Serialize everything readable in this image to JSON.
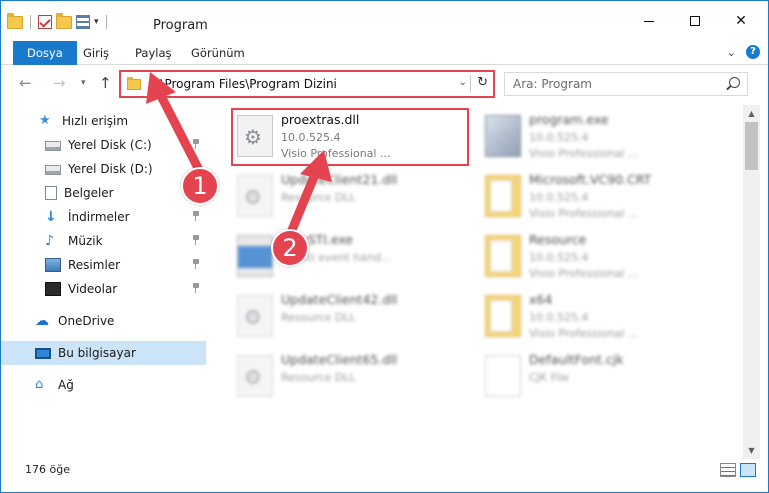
{
  "window": {
    "title": "Program",
    "controls": {
      "minimize": "",
      "maximize": "",
      "close": "✕"
    }
  },
  "ribbon": {
    "tabs": [
      "Dosya",
      "Giriş",
      "Paylaş",
      "Görünüm"
    ]
  },
  "address": {
    "path": "C:\\Program Files\\Program Dizini",
    "search_placeholder": "Ara: Program"
  },
  "sidebar": {
    "items": [
      {
        "label": "Hızlı erişim",
        "icon": "star-icon"
      },
      {
        "label": "Yerel Disk (C:)",
        "icon": "disk-icon",
        "pinned": true
      },
      {
        "label": "Yerel Disk (D:)",
        "icon": "disk-icon",
        "pinned": true
      },
      {
        "label": "Belgeler",
        "icon": "documents-icon",
        "pinned": true
      },
      {
        "label": "İndirmeler",
        "icon": "downloads-icon",
        "pinned": true
      },
      {
        "label": "Müzik",
        "icon": "music-icon",
        "pinned": true
      },
      {
        "label": "Resimler",
        "icon": "pictures-icon",
        "pinned": true
      },
      {
        "label": "Videolar",
        "icon": "videos-icon",
        "pinned": true
      },
      {
        "label": "OneDrive",
        "icon": "onedrive-icon"
      },
      {
        "label": "Bu bilgisayar",
        "icon": "computer-icon",
        "selected": true
      },
      {
        "label": "Ağ",
        "icon": "network-icon"
      }
    ]
  },
  "files": [
    {
      "name": "proextras.dll",
      "line2": "10.0.525.4",
      "line3": "Visio Professional ...",
      "icon": "dll-icon"
    },
    {
      "name": "program.exe",
      "line2": "10.0.525.4",
      "line3": "Visio Professional ...",
      "icon": "exe-icon"
    },
    {
      "name": "UpdateClient21.dll",
      "line2": "Resource DLL",
      "line3": "",
      "icon": "dll-icon"
    },
    {
      "name": "Microsoft.VC90.CRT",
      "line2": "10.0.525.4",
      "line3": "Visio Professional ...",
      "icon": "folder-icon"
    },
    {
      "name": "...yySTI.exe",
      "line2": "...Y sti event hand...",
      "line3": "",
      "icon": "app-icon"
    },
    {
      "name": "Resource",
      "line2": "10.0.525.4",
      "line3": "Visio Professional ...",
      "icon": "folder-icon"
    },
    {
      "name": "UpdateClient42.dll",
      "line2": "Resource DLL",
      "line3": "",
      "icon": "dll-icon"
    },
    {
      "name": "x64",
      "line2": "10.0.525.4",
      "line3": "Visio Professional ...",
      "icon": "folder-icon"
    },
    {
      "name": "UpdateClient65.dll",
      "line2": "Resource DLL",
      "line3": "",
      "icon": "dll-icon"
    },
    {
      "name": "DefaultFont.cjk",
      "line2": "CJK File",
      "line3": "",
      "icon": "text-file-icon"
    }
  ],
  "status": {
    "item_count": "176 öğe"
  },
  "annotations": {
    "callout_1": "1",
    "callout_2": "2",
    "color": "#e44450"
  },
  "colors": {
    "accent": "#1979ca",
    "selection": "#cce4f7",
    "highlight": "#e44450"
  }
}
